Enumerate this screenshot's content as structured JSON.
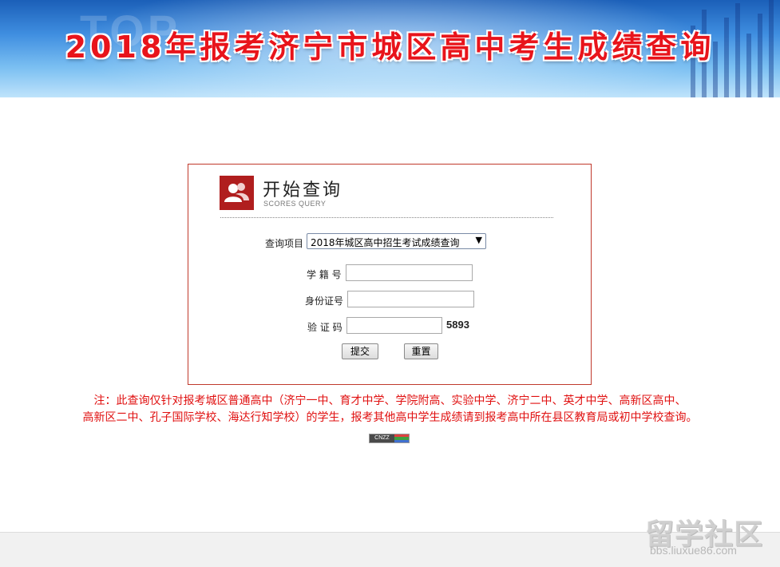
{
  "header": {
    "title": "2018年报考济宁市城区高中考生成绩查询",
    "watermark": "TOP"
  },
  "panel": {
    "title": "开始查询",
    "subtitle": "SCORES QUERY",
    "query_label": "查询项目",
    "query_selected": "2018年城区高中招生考试成绩查询",
    "student_id_label": "学 籍 号",
    "id_card_label": "身份证号",
    "captcha_label": "验 证 码",
    "captcha_code": "5893",
    "submit_label": "提交",
    "reset_label": "重置"
  },
  "notice": {
    "line1": "注：此查询仅针对报考城区普通高中（济宁一中、育才中学、学院附高、实验中学、济宁二中、英才中学、高新区高中、",
    "line2": "高新区二中、孔子国际学校、海达行知学校）的学生，报考其他高中学生成绩请到报考高中所在县区教育局或初中学校查询。"
  },
  "stats_badge": "CNZZ",
  "watermark_site": {
    "logo": "留学社区",
    "url": "bbs.liuxue86.com"
  },
  "colors": {
    "title_red": "#e8141b",
    "panel_border": "#c0392b",
    "notice_red": "#e01010",
    "logo_red": "#b01e1e"
  }
}
